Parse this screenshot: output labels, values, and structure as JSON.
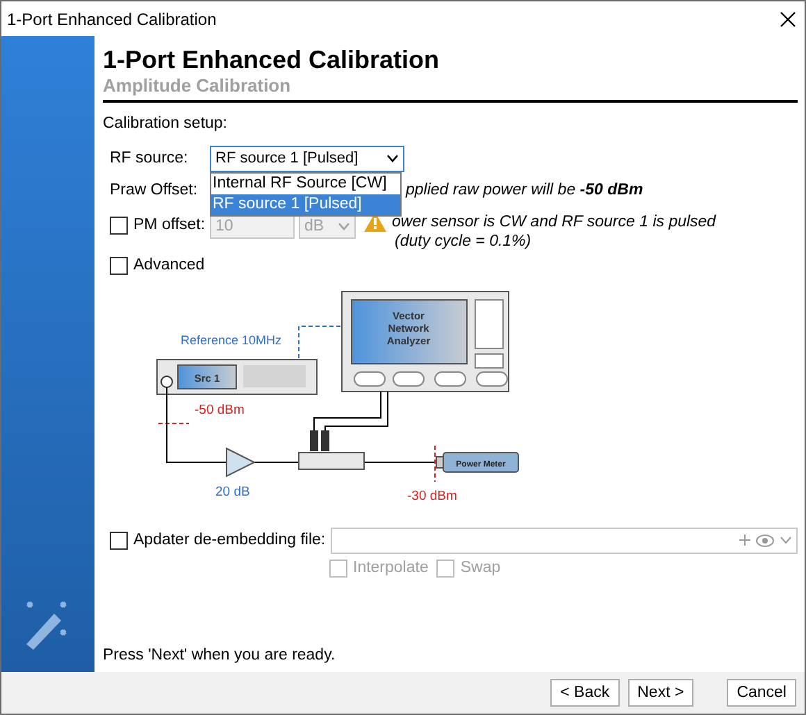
{
  "window": {
    "title": "1-Port Enhanced Calibration"
  },
  "header": {
    "title": "1-Port Enhanced Calibration",
    "subtitle": "Amplitude Calibration"
  },
  "section_label": "Calibration setup:",
  "rf_source": {
    "label": "RF source:",
    "value": "RF source 1 [Pulsed]",
    "expanded": true,
    "options": [
      {
        "label": "Internal RF Source [CW]",
        "selected": false
      },
      {
        "label": "RF source 1 [Pulsed]",
        "selected": true
      }
    ]
  },
  "praw_offset": {
    "label": "Praw Offset:",
    "message": "pplied raw power will be **-50 dBm**"
  },
  "pm_offset": {
    "label": "PM offset:",
    "checked": false,
    "value": "10",
    "unit": "dB",
    "disabled": true,
    "warning": [
      "ower sensor is CW and RF source 1 is pulsed",
      "(duty cycle = 0.1%)"
    ]
  },
  "advanced": {
    "label": "Advanced",
    "checked": false
  },
  "diagram": {
    "vna_label": [
      "Vector",
      "Network",
      "Analyzer"
    ],
    "source_label": "Src 1",
    "reference": "Reference 10MHz",
    "source_power": "-50 dBm",
    "amplifier_gain": "20 dB",
    "meter_label": "Power Meter",
    "meter_power": "-30 dBm"
  },
  "adapter": {
    "label": "Apdater de-embedding file:",
    "checked": false,
    "options": [
      {
        "label": "Interpolate",
        "checked": false,
        "disabled": true
      },
      {
        "label": "Swap",
        "checked": false,
        "disabled": true
      }
    ]
  },
  "hint": "Press 'Next' when you are ready.",
  "buttons": [
    "< Back",
    "Next >",
    "Cancel"
  ]
}
